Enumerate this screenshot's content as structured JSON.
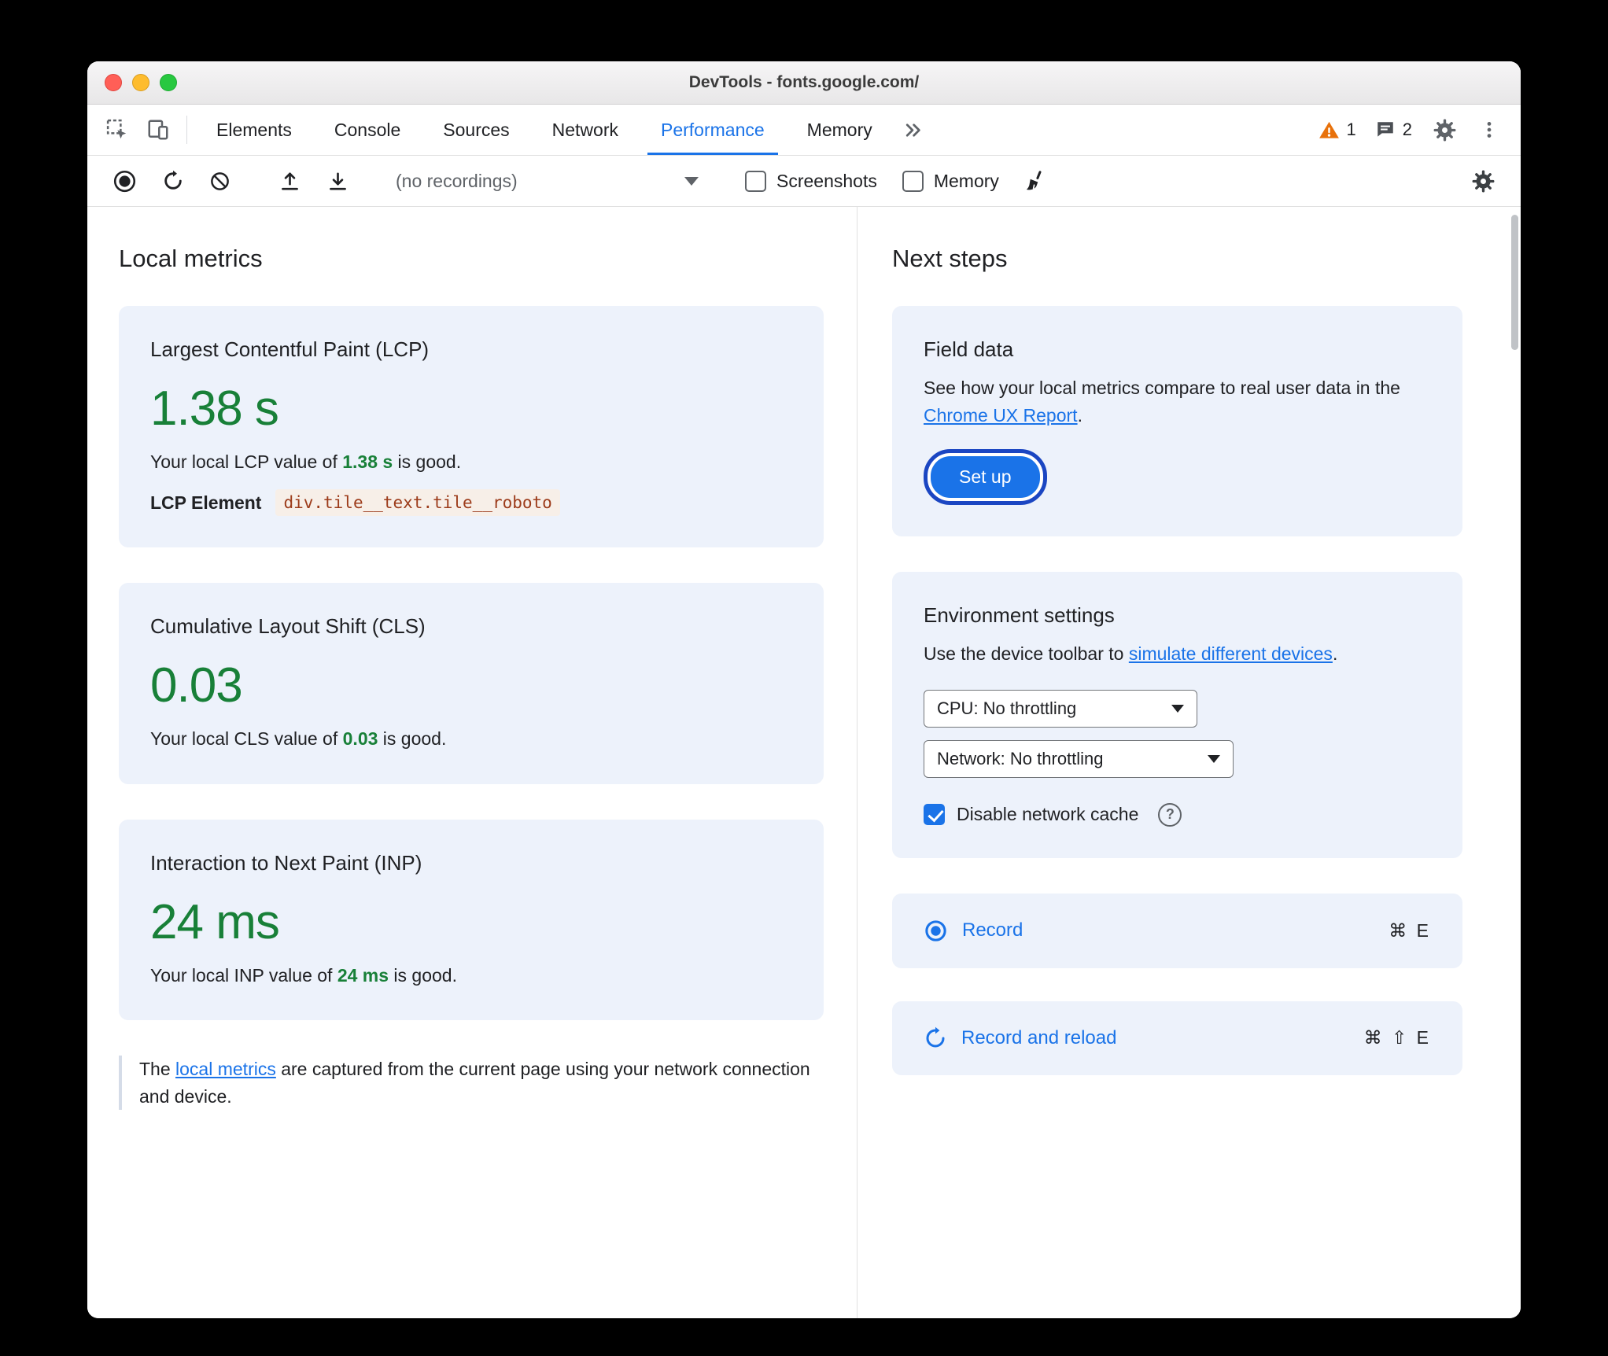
{
  "window": {
    "title": "DevTools - fonts.google.com/"
  },
  "colors": {
    "accent_blue": "#1a73e8",
    "good_green": "#188038",
    "warning_orange": "#e8710a",
    "card_background": "#edf2fb",
    "code_text": "#9c3b1a"
  },
  "tabbar": {
    "tabs": [
      "Elements",
      "Console",
      "Sources",
      "Network",
      "Performance",
      "Memory"
    ],
    "active_tab": "Performance",
    "warning_count": "1",
    "issue_count": "2"
  },
  "toolbar": {
    "recordings_select": "(no recordings)",
    "screenshots_label": "Screenshots",
    "memory_label": "Memory"
  },
  "local_metrics": {
    "heading": "Local metrics",
    "lcp": {
      "title": "Largest Contentful Paint (LCP)",
      "value": "1.38 s",
      "desc_pre": "Your local LCP value of ",
      "desc_value": "1.38 s",
      "desc_post": " is good.",
      "element_label": "LCP Element",
      "element_value": "div.tile__text.tile__roboto"
    },
    "cls": {
      "title": "Cumulative Layout Shift (CLS)",
      "value": "0.03",
      "desc_pre": "Your local CLS value of ",
      "desc_value": "0.03",
      "desc_post": " is good."
    },
    "inp": {
      "title": "Interaction to Next Paint (INP)",
      "value": "24 ms",
      "desc_pre": "Your local INP value of ",
      "desc_value": "24 ms",
      "desc_post": " is good."
    },
    "note": {
      "pre": "The ",
      "link": "local metrics",
      "post": " are captured from the current page using your network connection and device."
    }
  },
  "next_steps": {
    "heading": "Next steps",
    "field_data": {
      "title": "Field data",
      "desc_pre": "See how your local metrics compare to real user data in the ",
      "desc_link": "Chrome UX Report",
      "desc_post": ".",
      "setup_button": "Set up"
    },
    "environment": {
      "title": "Environment settings",
      "desc_pre": "Use the device toolbar to ",
      "desc_link": "simulate different devices",
      "desc_post": ".",
      "cpu_select": "CPU: No throttling",
      "network_select": "Network: No throttling",
      "cache_checkbox": "Disable network cache"
    },
    "record": {
      "label": "Record",
      "shortcut": "⌘ E"
    },
    "record_reload": {
      "label": "Record and reload",
      "shortcut": "⌘ ⇧ E"
    }
  }
}
